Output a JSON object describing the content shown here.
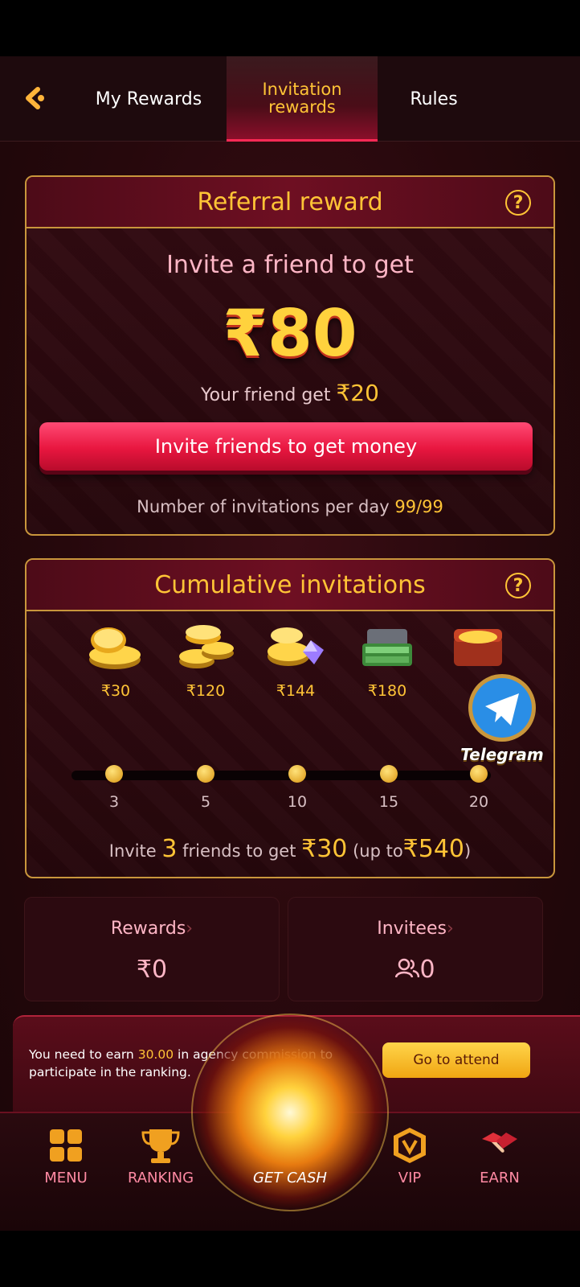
{
  "header": {
    "tabs": [
      {
        "label": "My Rewards",
        "active": false
      },
      {
        "label": "Invitation rewards",
        "active": true
      },
      {
        "label": "Rules",
        "active": false
      }
    ]
  },
  "referral": {
    "title": "Referral reward",
    "invite_line": "Invite a friend to get",
    "amount": "₹80",
    "friend_text": "Your friend get",
    "friend_amount": "₹20",
    "button_label": "Invite friends to get money",
    "per_day_text": "Number of invitations per day",
    "per_day_count": "99/99"
  },
  "cumulative": {
    "title": "Cumulative invitations",
    "rewards": [
      {
        "label": "₹30",
        "icon": "coin-stack-icon"
      },
      {
        "label": "₹120",
        "icon": "coin-pile-icon"
      },
      {
        "label": "₹144",
        "icon": "coins-gems-icon"
      },
      {
        "label": "₹180",
        "icon": "treasure-cash-icon"
      },
      {
        "label": "",
        "icon": "treasure-chest-icon"
      }
    ],
    "milestones": [
      "3",
      "5",
      "10",
      "15",
      "20"
    ],
    "summary": {
      "p1": "Invite",
      "count": "3",
      "p2": "friends to get",
      "amount": "₹30",
      "p3": "(up to",
      "max": "₹540",
      "p4": ")"
    }
  },
  "stats": {
    "rewards_label": "Rewards",
    "rewards_value": "₹0",
    "invitees_label": "Invitees",
    "invitees_value": "0"
  },
  "ranking_banner": {
    "text1": "You need to earn",
    "amount": "30.00",
    "text2": "in agency commission to participate in the ranking.",
    "button": "Go to attend"
  },
  "telegram_badge": "Telegram",
  "nav": {
    "menu": "MENU",
    "ranking": "RANKING",
    "get_cash": "GET CASH",
    "vip": "VIP",
    "earn": "EARN"
  },
  "colors": {
    "accent_gold": "#ffc436",
    "accent_pink": "#ff2a55",
    "bg_dark": "#26070c"
  }
}
